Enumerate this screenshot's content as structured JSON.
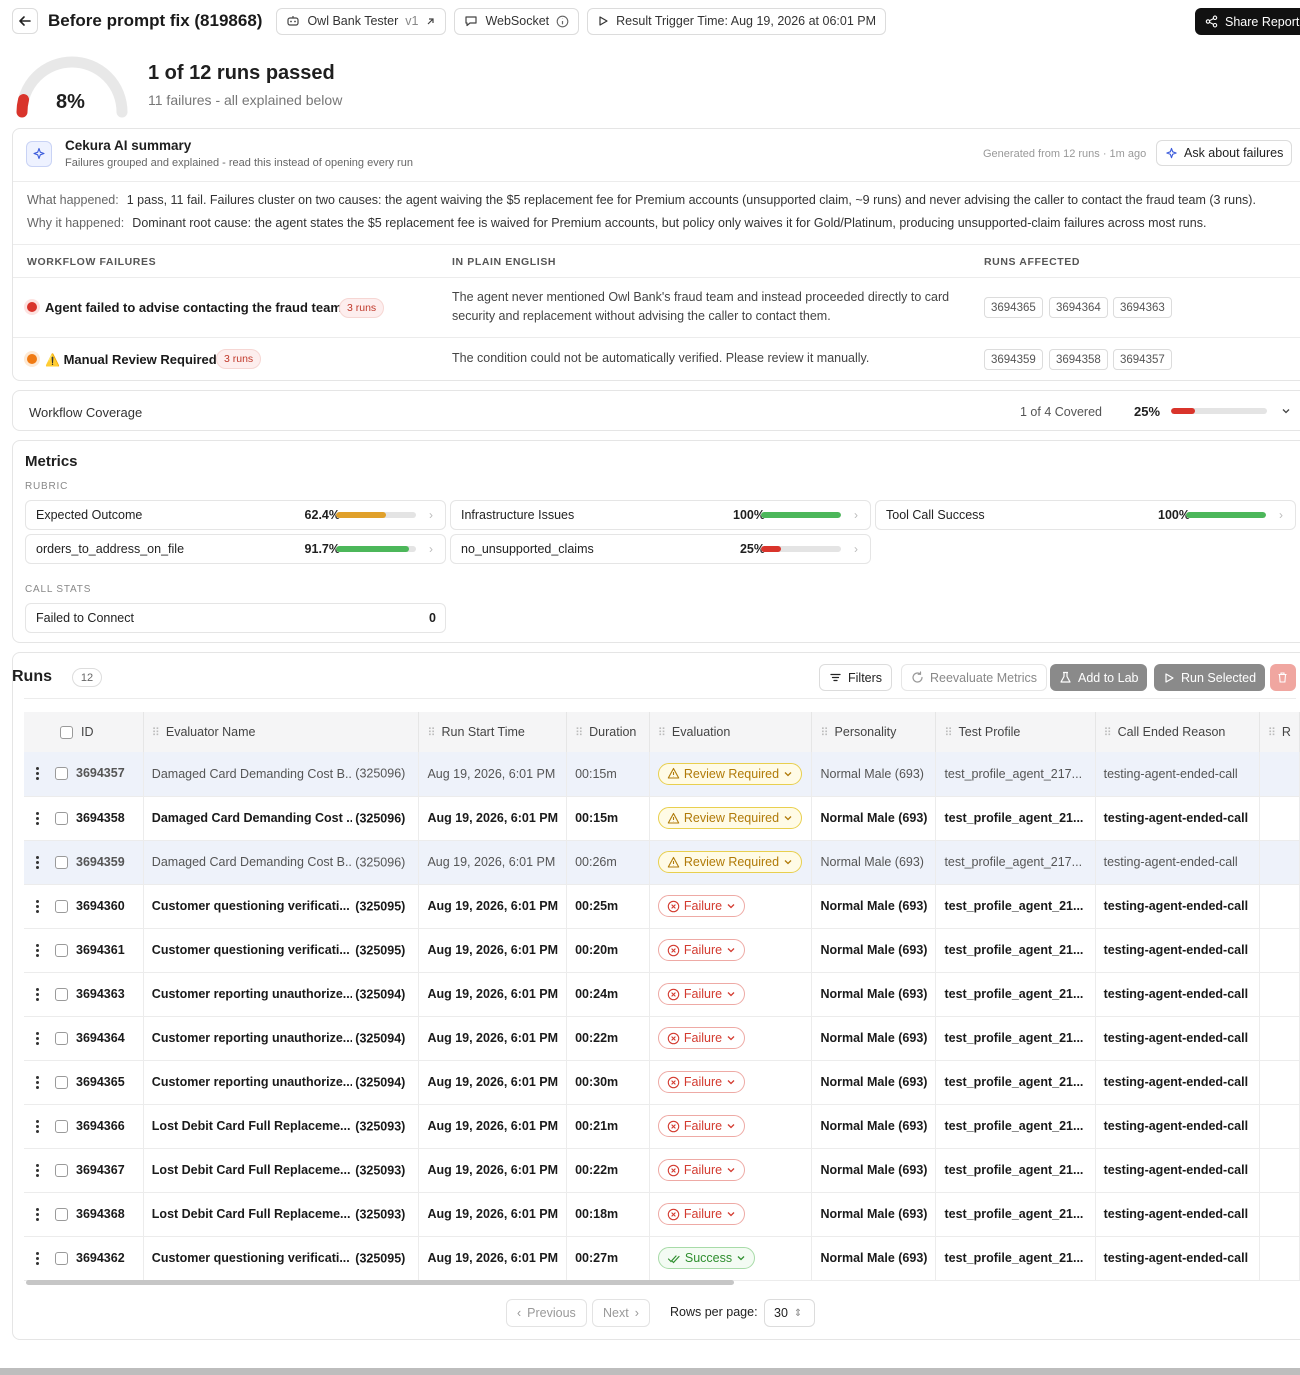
{
  "header": {
    "title": "Before prompt fix (819868)",
    "agent_chip": "Owl Bank Tester",
    "agent_version": "v1",
    "transport_chip": "WebSocket",
    "trigger_chip": "Result Trigger Time: Aug 19, 2026 at 06:01 PM",
    "share_label": "Share Report"
  },
  "score": {
    "percent": "8%",
    "percent_value": 0.08,
    "title": "1 of 12 runs passed",
    "subtitle": "11 failures - all explained below"
  },
  "ai_summary": {
    "title": "Cekura AI summary",
    "subtitle": "Failures grouped and explained - read this instead of opening every run",
    "generated": "Generated from 12 runs · 1m ago",
    "ask_label": "Ask about failures",
    "what_label": "What happened:",
    "what_text": "1 pass, 11 fail. Failures cluster on two causes: the agent waiving the $5 replacement fee for Premium accounts (unsupported claim, ~9 runs) and never advising the caller to contact the fraud team (3 runs).",
    "why_label": "Why it happened:",
    "why_text": "Dominant root cause: the agent states the $5 replacement fee is waived for Premium accounts, but policy only waives it for Gold/Platinum, producing unsupported-claim failures across most runs.",
    "columns": [
      "WORKFLOW FAILURES",
      "IN PLAIN ENGLISH",
      "RUNS AFFECTED"
    ],
    "failures": [
      {
        "name": "Agent failed to advise contacting the fraud team",
        "runs": "3 runs",
        "plain": "The agent never mentioned Owl Bank's fraud team and instead proceeded directly to card security and replacement without advising the caller to contact them.",
        "ids": [
          "3694365",
          "3694364",
          "3694363"
        ],
        "color": "#d9342b"
      },
      {
        "name": "Manual Review Required",
        "warn": "⚠️",
        "runs": "3 runs",
        "plain": "The condition could not be automatically verified. Please review it manually.",
        "ids": [
          "3694359",
          "3694358",
          "3694357"
        ],
        "color": "#f07a12"
      }
    ]
  },
  "coverage": {
    "label": "Workflow Coverage",
    "count": "1 of 4 Covered",
    "percent": "25%",
    "value": 0.25
  },
  "metrics": {
    "title": "Metrics",
    "rubric_label": "RUBRIC",
    "items": [
      {
        "name": "Expected Outcome",
        "value": "62.4%",
        "fraction": 0.624,
        "color": "#e0a02a"
      },
      {
        "name": "Infrastructure Issues",
        "value": "100%",
        "fraction": 1.0,
        "color": "#4cb75a"
      },
      {
        "name": "Tool Call Success",
        "value": "100%",
        "fraction": 1.0,
        "color": "#4cb75a"
      },
      {
        "name": "orders_to_address_on_file",
        "value": "91.7%",
        "fraction": 0.917,
        "color": "#4cb75a"
      },
      {
        "name": "no_unsupported_claims",
        "value": "25%",
        "fraction": 0.25,
        "color": "#d9342b"
      }
    ],
    "call_stats_label": "CALL STATS",
    "call_stats": [
      {
        "name": "Failed to Connect",
        "value": "0"
      }
    ]
  },
  "runs": {
    "title": "Runs",
    "count": "12",
    "filters_label": "Filters",
    "reevaluate_label": "Reevaluate Metrics",
    "add_lab_label": "Add to Lab",
    "run_selected_label": "Run Selected",
    "columns": [
      "ID",
      "Evaluator Name",
      "Run Start Time",
      "Duration",
      "Evaluation",
      "Personality",
      "Test Profile",
      "Call Ended Reason",
      "R"
    ],
    "rows": [
      {
        "id": "3694357",
        "name": "Damaged Card Demanding Cost B...",
        "eid": "(325096)",
        "start": "Aug 19, 2026, 6:01 PM",
        "dur": "00:15m",
        "eval": "Review Required",
        "kind": "rev",
        "pers": "Normal Male (693)",
        "profile": "test_profile_agent_217...",
        "reason": "testing-agent-ended-call",
        "style": "hl dim"
      },
      {
        "id": "3694358",
        "name": "Damaged Card Demanding Cost ...",
        "eid": "(325096)",
        "start": "Aug 19, 2026, 6:01 PM",
        "dur": "00:15m",
        "eval": "Review Required",
        "kind": "rev",
        "pers": "Normal Male (693)",
        "profile": "test_profile_agent_21...",
        "reason": "testing-agent-ended-call",
        "style": "bold"
      },
      {
        "id": "3694359",
        "name": "Damaged Card Demanding Cost B...",
        "eid": "(325096)",
        "start": "Aug 19, 2026, 6:01 PM",
        "dur": "00:26m",
        "eval": "Review Required",
        "kind": "rev",
        "pers": "Normal Male (693)",
        "profile": "test_profile_agent_217...",
        "reason": "testing-agent-ended-call",
        "style": "hl dim"
      },
      {
        "id": "3694360",
        "name": "Customer questioning verificati...",
        "eid": "(325095)",
        "start": "Aug 19, 2026, 6:01 PM",
        "dur": "00:25m",
        "eval": "Failure",
        "kind": "fail",
        "pers": "Normal Male (693)",
        "profile": "test_profile_agent_21...",
        "reason": "testing-agent-ended-call",
        "style": "bold"
      },
      {
        "id": "3694361",
        "name": "Customer questioning verificati...",
        "eid": "(325095)",
        "start": "Aug 19, 2026, 6:01 PM",
        "dur": "00:20m",
        "eval": "Failure",
        "kind": "fail",
        "pers": "Normal Male (693)",
        "profile": "test_profile_agent_21...",
        "reason": "testing-agent-ended-call",
        "style": "bold"
      },
      {
        "id": "3694363",
        "name": "Customer reporting unauthorize...",
        "eid": "(325094)",
        "start": "Aug 19, 2026, 6:01 PM",
        "dur": "00:24m",
        "eval": "Failure",
        "kind": "fail",
        "pers": "Normal Male (693)",
        "profile": "test_profile_agent_21...",
        "reason": "testing-agent-ended-call",
        "style": "bold"
      },
      {
        "id": "3694364",
        "name": "Customer reporting unauthorize...",
        "eid": "(325094)",
        "start": "Aug 19, 2026, 6:01 PM",
        "dur": "00:22m",
        "eval": "Failure",
        "kind": "fail",
        "pers": "Normal Male (693)",
        "profile": "test_profile_agent_21...",
        "reason": "testing-agent-ended-call",
        "style": "bold"
      },
      {
        "id": "3694365",
        "name": "Customer reporting unauthorize...",
        "eid": "(325094)",
        "start": "Aug 19, 2026, 6:01 PM",
        "dur": "00:30m",
        "eval": "Failure",
        "kind": "fail",
        "pers": "Normal Male (693)",
        "profile": "test_profile_agent_21...",
        "reason": "testing-agent-ended-call",
        "style": "bold"
      },
      {
        "id": "3694366",
        "name": "Lost Debit Card Full Replaceme...",
        "eid": "(325093)",
        "start": "Aug 19, 2026, 6:01 PM",
        "dur": "00:21m",
        "eval": "Failure",
        "kind": "fail",
        "pers": "Normal Male (693)",
        "profile": "test_profile_agent_21...",
        "reason": "testing-agent-ended-call",
        "style": "bold"
      },
      {
        "id": "3694367",
        "name": "Lost Debit Card Full Replaceme...",
        "eid": "(325093)",
        "start": "Aug 19, 2026, 6:01 PM",
        "dur": "00:22m",
        "eval": "Failure",
        "kind": "fail",
        "pers": "Normal Male (693)",
        "profile": "test_profile_agent_21...",
        "reason": "testing-agent-ended-call",
        "style": "bold"
      },
      {
        "id": "3694368",
        "name": "Lost Debit Card Full Replaceme...",
        "eid": "(325093)",
        "start": "Aug 19, 2026, 6:01 PM",
        "dur": "00:18m",
        "eval": "Failure",
        "kind": "fail",
        "pers": "Normal Male (693)",
        "profile": "test_profile_agent_21...",
        "reason": "testing-agent-ended-call",
        "style": "bold"
      },
      {
        "id": "3694362",
        "name": "Customer questioning verificati...",
        "eid": "(325095)",
        "start": "Aug 19, 2026, 6:01 PM",
        "dur": "00:27m",
        "eval": "Success",
        "kind": "succ",
        "pers": "Normal Male (693)",
        "profile": "test_profile_agent_21...",
        "reason": "testing-agent-ended-call",
        "style": "bold"
      }
    ]
  },
  "pagination": {
    "previous_label": "Previous",
    "next_label": "Next",
    "rows_per_page_label": "Rows per page:",
    "rows_per_page_value": "30"
  }
}
